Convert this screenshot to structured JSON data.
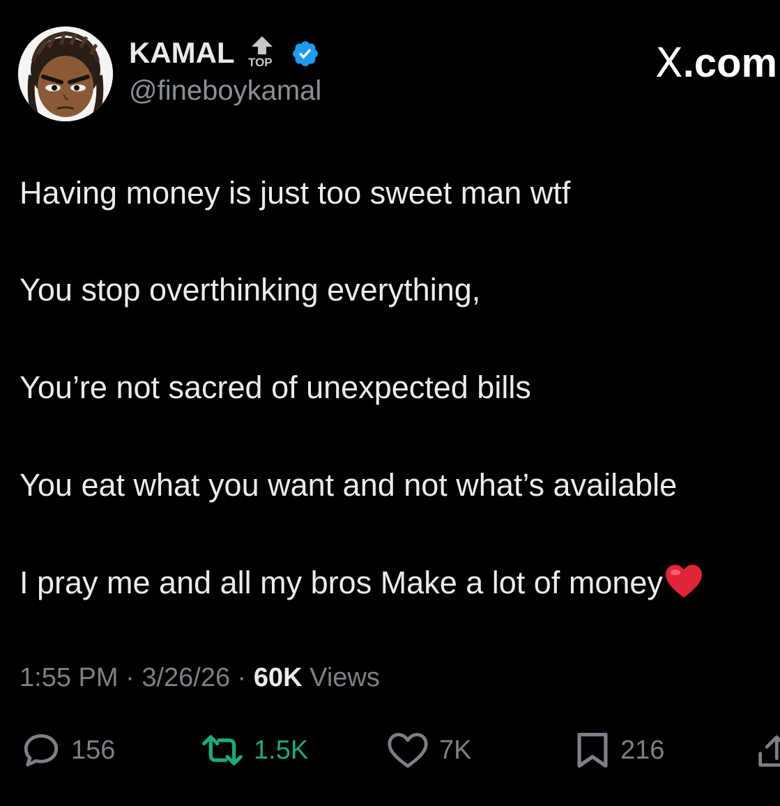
{
  "author": {
    "display_name": "KAMAL",
    "badge_label": "TOP",
    "handle": "@fineboykamal",
    "verified_icon": "verified-badge-icon",
    "verified_color": "#1d9bf0"
  },
  "brand": {
    "x_glyph": "X",
    "suffix": ".com"
  },
  "tweet": {
    "lines": [
      "Having money is just too sweet man wtf",
      "You stop overthinking everything,",
      "You’re not sacred of unexpected bills",
      "You eat what you want and not what’s available",
      "I pray me and all my bros Make a lot of money"
    ],
    "emoji_icon": "red-heart-icon"
  },
  "meta": {
    "time": "1:55 PM",
    "separator": " · ",
    "date": "3/26/26",
    "views_count": "60K",
    "views_label": " Views"
  },
  "actions": {
    "reply": {
      "icon": "reply-icon",
      "count": "156"
    },
    "retweet": {
      "icon": "retweet-icon",
      "count": "1.5K",
      "color": "#1ea97c"
    },
    "like": {
      "icon": "heart-outline-icon",
      "count": "7K"
    },
    "bookmark": {
      "icon": "bookmark-icon",
      "count": "216"
    },
    "share": {
      "icon": "share-icon"
    }
  },
  "colors": {
    "background": "#000000",
    "text": "#e7e9ea",
    "muted": "#7d8186",
    "accent_green": "#1ea97c",
    "heart_red": "#e0243a"
  }
}
